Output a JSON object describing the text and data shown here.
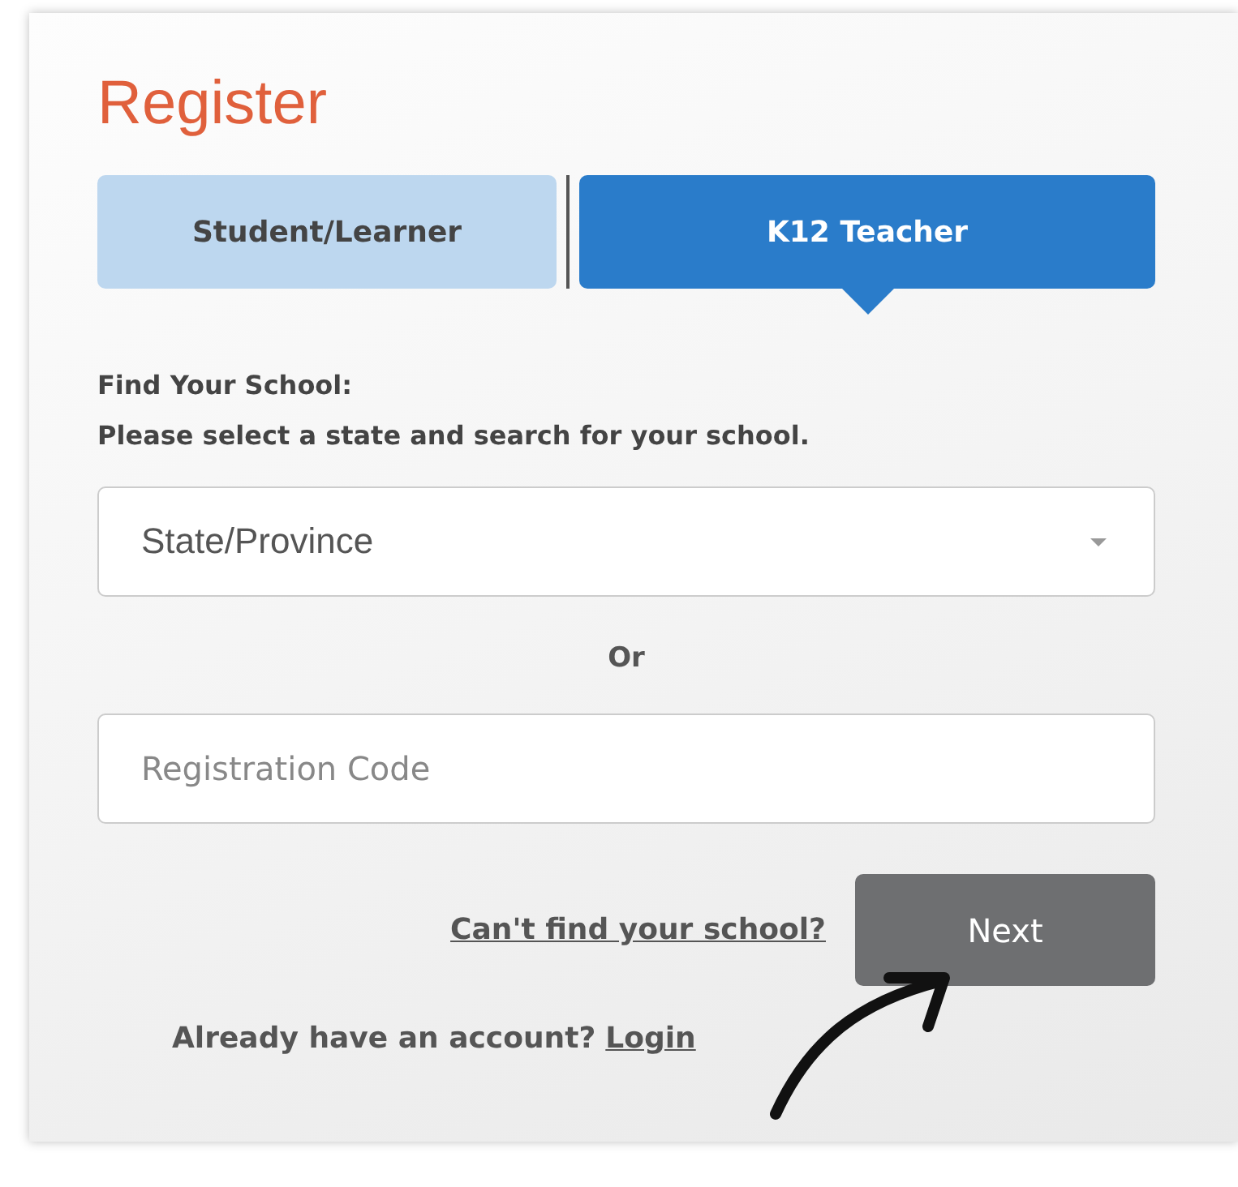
{
  "title": "Register",
  "tabs": [
    {
      "label": "Student/Learner",
      "selected": false
    },
    {
      "label": "K12 Teacher",
      "selected": true
    }
  ],
  "instructions": [
    "Find Your School:",
    "Please select a state and search for your school."
  ],
  "state_select": {
    "placeholder": "State/Province"
  },
  "separator": "Or",
  "registration_code": {
    "placeholder": "Registration Code"
  },
  "cant_find_link": "Can't find your school?",
  "next_button": "Next",
  "login_prompt": "Already have an account?",
  "login_link": "Login"
}
